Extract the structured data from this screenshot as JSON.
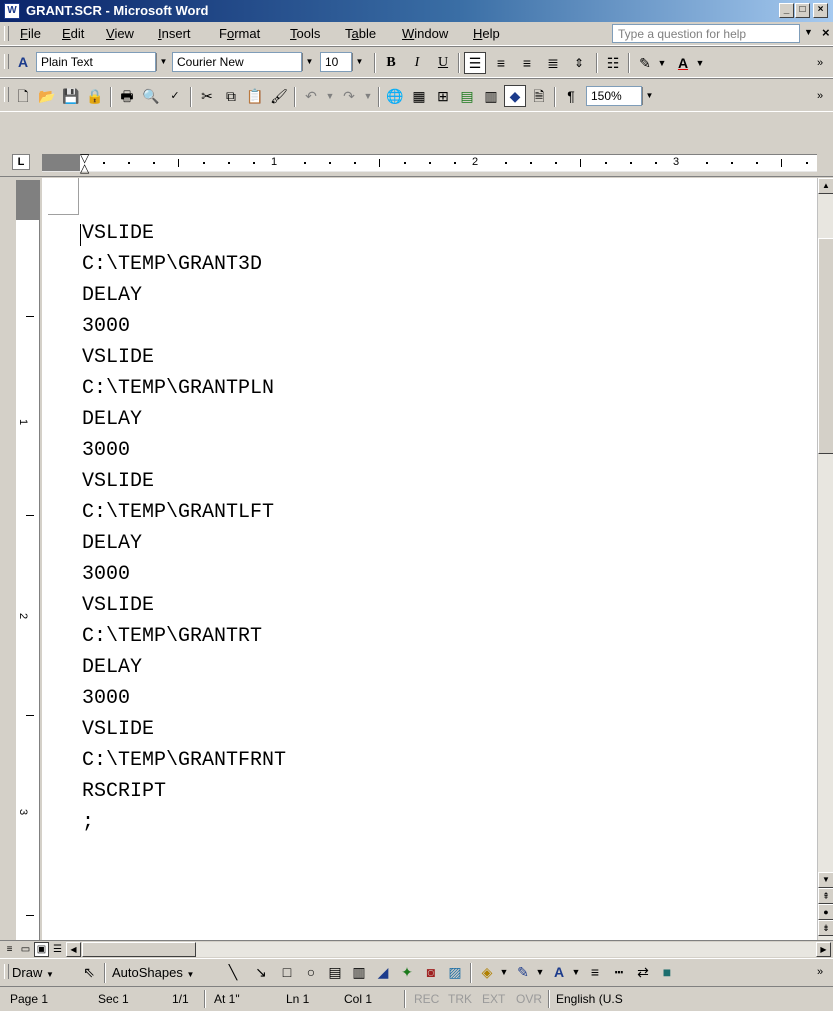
{
  "window": {
    "title": "GRANT.SCR - Microsoft Word",
    "app_icon": "W",
    "caption_buttons": [
      "_",
      "□",
      "×"
    ]
  },
  "menubar": {
    "items": [
      {
        "label": "File",
        "underline": "F"
      },
      {
        "label": "Edit",
        "underline": "E"
      },
      {
        "label": "View",
        "underline": "V"
      },
      {
        "label": "Insert",
        "underline": "I"
      },
      {
        "label": "Format",
        "underline": "o"
      },
      {
        "label": "Tools",
        "underline": "T"
      },
      {
        "label": "Table",
        "underline": "a"
      },
      {
        "label": "Window",
        "underline": "W"
      },
      {
        "label": "Help",
        "underline": "H"
      }
    ],
    "help_placeholder": "Type a question for help"
  },
  "formatting": {
    "style_value": "Plain Text",
    "font_value": "Courier New",
    "size_value": "10",
    "bold": "B",
    "italic": "I",
    "underline": "U"
  },
  "standard": {
    "zoom_value": "150%"
  },
  "ruler": {
    "numbers": [
      "1",
      "2",
      "3"
    ],
    "tab_selector": "L"
  },
  "vruler_numbers": [
    "1",
    "2",
    "3"
  ],
  "document": {
    "lines": [
      "VSLIDE",
      "C:\\TEMP\\GRANT3D",
      "DELAY",
      "3000",
      "VSLIDE",
      "C:\\TEMP\\GRANTPLN",
      "DELAY",
      "3000",
      "VSLIDE",
      "C:\\TEMP\\GRANTLFT",
      "DELAY",
      "3000",
      "VSLIDE",
      "C:\\TEMP\\GRANTRT",
      "DELAY",
      "3000",
      "VSLIDE",
      "C:\\TEMP\\GRANTFRNT",
      "RSCRIPT",
      ";"
    ]
  },
  "drawbar": {
    "draw_label": "Draw",
    "autoshapes_label": "AutoShapes"
  },
  "status": {
    "page": "Page 1",
    "sec": "Sec 1",
    "pages": "1/1",
    "at": "At 1\"",
    "ln": "Ln 1",
    "col": "Col 1",
    "rec": "REC",
    "trk": "TRK",
    "ext": "EXT",
    "ovr": "OVR",
    "language": "English (U.S"
  },
  "colors": {
    "title_gradient_start": "#0a246a",
    "title_gradient_end": "#a6caf0",
    "chrome": "#d4d0c8",
    "document_bg": "#ffffff"
  }
}
